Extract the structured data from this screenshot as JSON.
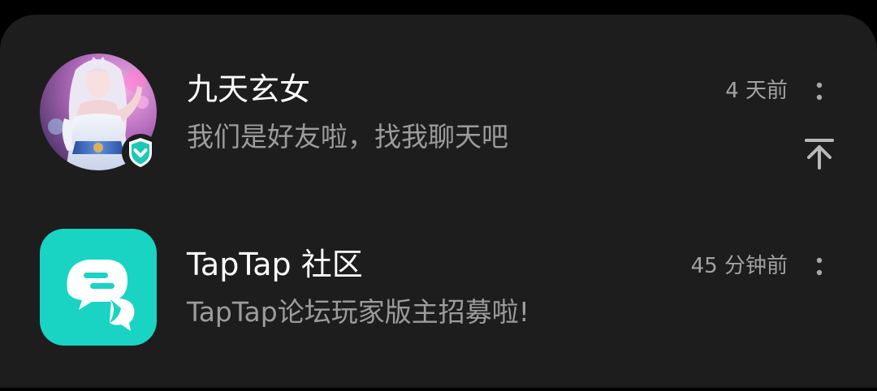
{
  "conversations": [
    {
      "name": "九天玄女",
      "preview": "我们是好友啦，找我聊天吧",
      "time": "4 天前",
      "avatar_icon": "character-portrait-avatar",
      "badge_icon": "verified-check-badge-icon",
      "pinned": true
    },
    {
      "name": "TapTap 社区",
      "preview": "TapTap论坛玩家版主招募啦!",
      "time": "45 分钟前",
      "avatar_icon": "taptap-chat-bubble-icon",
      "pinned": false
    }
  ],
  "colors": {
    "background": "#1d1d1d",
    "title": "#ffffff",
    "preview": "#9c9c9c",
    "badge": "#1bc9b6",
    "taptap_brand": "#19d4c3"
  }
}
